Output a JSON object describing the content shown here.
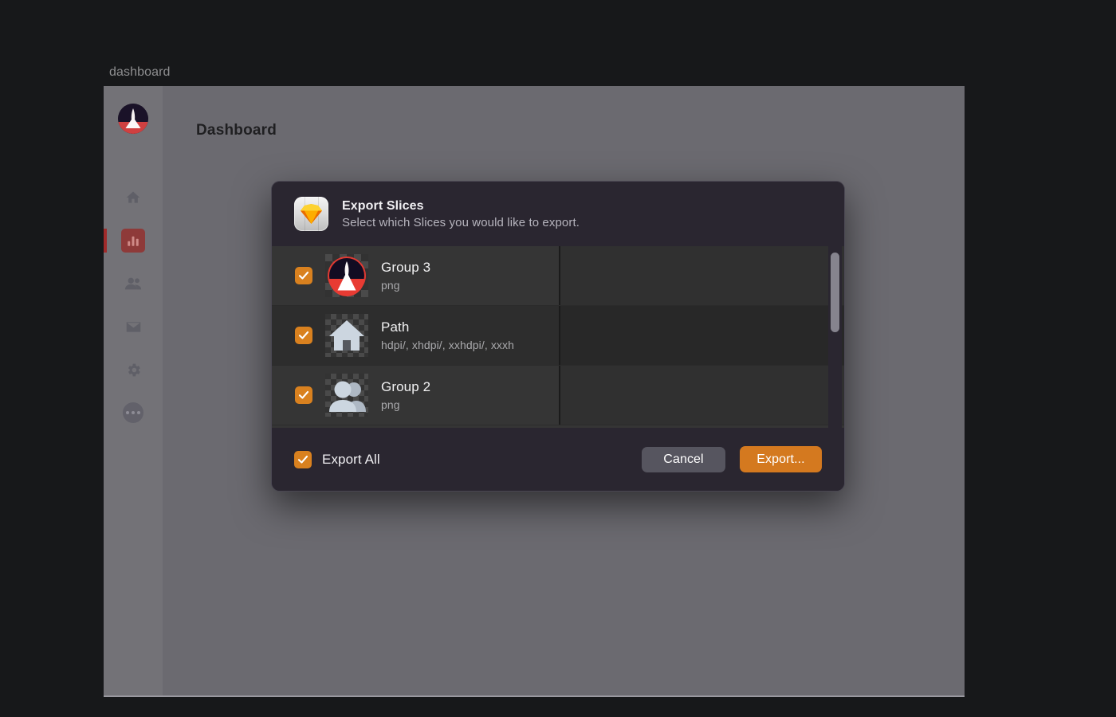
{
  "window": {
    "title": "dashboard"
  },
  "sidebar": {
    "avatar_name": "app-logo-avatar",
    "items": [
      {
        "icon": "home-icon",
        "label": "Home",
        "active": false
      },
      {
        "icon": "chart-bar-icon",
        "label": "Analytics",
        "active": true
      },
      {
        "icon": "people-icon",
        "label": "Users",
        "active": false
      },
      {
        "icon": "mail-icon",
        "label": "Mail",
        "active": false
      },
      {
        "icon": "gear-icon",
        "label": "Settings",
        "active": false
      },
      {
        "icon": "more-dots-icon",
        "label": "More",
        "active": false
      }
    ]
  },
  "page": {
    "title": "Dashboard"
  },
  "dialog": {
    "app_icon": "sketch-app-icon",
    "title": "Export Slices",
    "subtitle": "Select which Slices you would like to export.",
    "slices": [
      {
        "name": "Group 3",
        "formats": "png",
        "checked": true,
        "thumbnail": "rocket-logo-thumbnail"
      },
      {
        "name": "Path",
        "formats": "hdpi/, xhdpi/, xxhdpi/, xxxh",
        "checked": true,
        "thumbnail": "house-icon-thumbnail"
      },
      {
        "name": "Group 2",
        "formats": "png",
        "checked": true,
        "thumbnail": "people-icon-thumbnail"
      }
    ],
    "footer": {
      "export_all_label": "Export All",
      "export_all_checked": true,
      "cancel_label": "Cancel",
      "export_label": "Export..."
    }
  },
  "colors": {
    "accent_orange": "#d9811f",
    "export_button": "#d4791f",
    "cancel_button": "#56555f",
    "dialog_bg": "#2a2630",
    "list_row": "#353535",
    "list_row_alt": "#2d2d2d",
    "sidebar_active": "#8e3a39",
    "page_bg": "#17181a",
    "window_bg": "#6b6a70"
  }
}
